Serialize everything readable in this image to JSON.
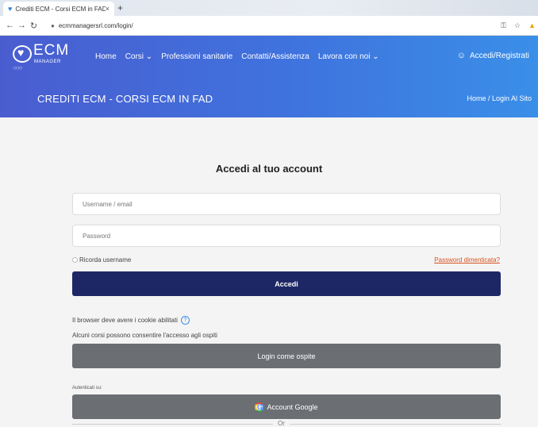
{
  "browser": {
    "tab_title": "Crediti ECM - Corsi ECM in FAD",
    "tab_close": "×",
    "new_tab": "+",
    "url": "ecmmanagersrl.com/login/"
  },
  "site": {
    "logo_text": "ECM",
    "logo_subtext": "MANAGER",
    "nav": [
      {
        "label": "Home"
      },
      {
        "label": "Corsi ⌄"
      },
      {
        "label": "Professioni sanitarie"
      },
      {
        "label": "Contatti/Assistenza"
      },
      {
        "label": "Lavora con noi ⌄"
      }
    ],
    "login_link": "Accedi/Registrati",
    "page_title": "CREDITI ECM - CORSI ECM IN FAD",
    "breadcrumb": "Home / Login Al Sito"
  },
  "login": {
    "heading": "Accedi al tuo account",
    "username_placeholder": "Username / email",
    "password_placeholder": "Password",
    "remember_label": "Ricorda username",
    "forgot_link": "Password dimenticata?",
    "submit_label": "Accedi",
    "cookie_note": "Il browser deve avere i cookie abilitati",
    "guest_note": "Alcuni corsi possono consentire l'accesso agli ospiti",
    "guest_button": "Login come ospite",
    "auth_label": "Autenticati su:",
    "google_button": "Account Google",
    "or_text": "Or"
  },
  "colors": {
    "header_gradient_start": "#4a5dd0",
    "header_gradient_end": "#3a8fe8",
    "primary_button": "#1e2766",
    "secondary_button": "#6b6f74",
    "link_accent": "#d9531e"
  },
  "icons": [
    "back-icon",
    "forward-icon",
    "reload-icon",
    "lock-icon",
    "key-icon",
    "star-icon",
    "drive-icon",
    "user-icon",
    "help-icon",
    "google-icon"
  ]
}
